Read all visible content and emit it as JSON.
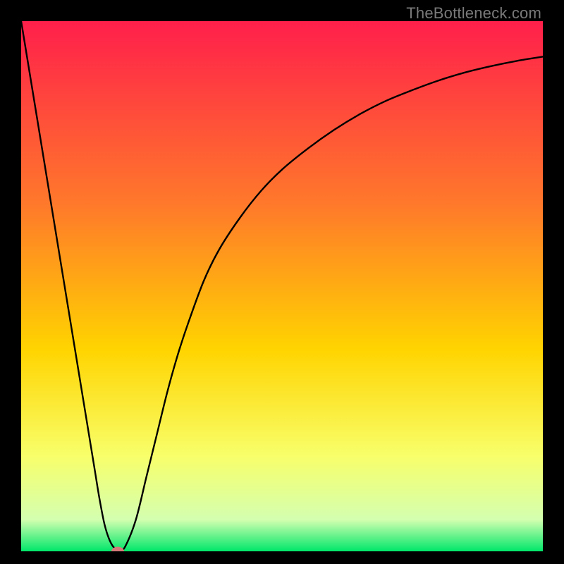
{
  "watermark": "TheBottleneck.com",
  "chart_data": {
    "type": "line",
    "title": "",
    "xlabel": "",
    "ylabel": "",
    "xlim": [
      0,
      100
    ],
    "ylim": [
      0,
      100
    ],
    "grid": false,
    "legend": false,
    "x": [
      0,
      2,
      4,
      6,
      8,
      10,
      12,
      14,
      15,
      16,
      17,
      18,
      19,
      20,
      22,
      24,
      26,
      28,
      30,
      32,
      35,
      38,
      42,
      46,
      50,
      55,
      60,
      65,
      70,
      75,
      80,
      85,
      90,
      95,
      100
    ],
    "y": [
      100,
      88,
      76,
      64,
      52,
      40,
      28,
      16,
      10,
      5,
      2,
      0.5,
      0.2,
      1,
      6,
      14,
      22,
      30,
      37,
      43,
      51,
      57,
      63,
      68,
      72,
      76,
      79.5,
      82.5,
      85,
      87,
      88.8,
      90.3,
      91.5,
      92.5,
      93.3
    ],
    "minimum_point": {
      "x": 18.5,
      "y": 0.0
    },
    "marker": {
      "x": 18.5,
      "y": 0.0,
      "color": "#d97a7a"
    }
  },
  "gradient": {
    "top": "#ff1f4b",
    "mid1": "#ff7a2a",
    "mid2": "#ffd400",
    "mid3": "#f8ff6a",
    "mid4": "#d4ffb0",
    "bottom": "#00e76a"
  }
}
